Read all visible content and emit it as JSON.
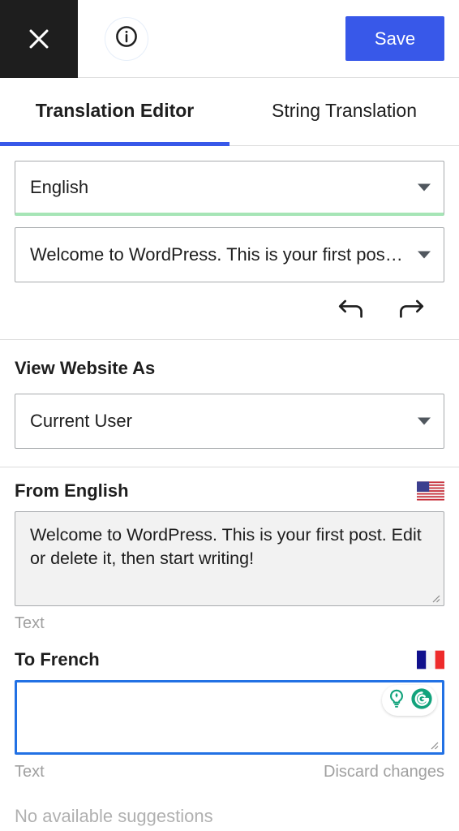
{
  "topbar": {
    "close_icon": "close-icon",
    "info_icon": "info-circle-icon",
    "save_label": "Save"
  },
  "tabs": [
    {
      "label": "Translation Editor",
      "active": true
    },
    {
      "label": "String Translation",
      "active": false
    }
  ],
  "source_panel": {
    "language_select": {
      "value": "English",
      "caret_icon": "chevron-down-icon"
    },
    "string_select": {
      "value": "Welcome to WordPress. This is your first post. Edi...",
      "caret_icon": "chevron-down-icon"
    },
    "undo_icon": "undo-arrow-icon",
    "redo_icon": "redo-arrow-icon"
  },
  "view_as": {
    "title": "View Website As",
    "select": {
      "value": "Current User",
      "caret_icon": "chevron-down-icon"
    }
  },
  "source_field": {
    "title": "From English",
    "flag_icon": "flag-usa-icon",
    "value": "Welcome to WordPress. This is your first post. Edit or delete it, then start writing!",
    "placeholder": "",
    "type_label": "Text",
    "resize_icon": "resize-grip-icon"
  },
  "target_field": {
    "title": "To French",
    "flag_icon": "flag-france-icon",
    "value": "",
    "placeholder": "",
    "type_label": "Text",
    "discard_label": "Discard changes",
    "resize_icon": "resize-grip-icon",
    "grammarly": {
      "bulb_icon": "lightbulb-idea-icon",
      "logo_icon": "grammarly-g-icon"
    }
  },
  "suggestions": {
    "empty_label": "No available suggestions"
  },
  "colors": {
    "accent_blue": "#3858e9",
    "focus_blue": "#2271e4",
    "dark_panel": "#1e1e1e",
    "green_underline": "#a6e5b6",
    "grammarly_green": "#15a37f",
    "muted_text": "#a0a0a0"
  }
}
